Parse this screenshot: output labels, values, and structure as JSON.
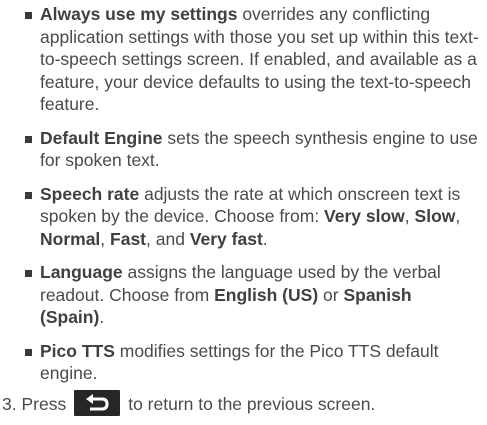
{
  "bullets": [
    {
      "term": "Always use my settings",
      "text": " overrides any conflicting application settings with those you set up within this text-to-speech settings screen. If enabled, and available as a feature, your device defaults to using the text-to-speech feature."
    },
    {
      "term": "Default Engine",
      "text": " sets the speech synthesis engine to use for spoken text."
    },
    {
      "term": "Speech rate",
      "text_a": " adjusts the rate at which onscreen text is spoken by the device. Choose from: ",
      "opt1": "Very slow",
      "sep1": ", ",
      "opt2": "Slow",
      "sep2": ", ",
      "opt3": "Normal",
      "sep3": ", ",
      "opt4": "Fast",
      "sep4": ", and ",
      "opt5": "Very fast",
      "end": "."
    },
    {
      "term": "Language",
      "text_a": " assigns the language used by the verbal readout. Choose from ",
      "opt1": "English (US)",
      "sep1": " or ",
      "opt2": "Spanish (Spain)",
      "end": "."
    },
    {
      "term": "Pico TTS",
      "text": " modifies settings for the Pico TTS default engine."
    }
  ],
  "step": {
    "number": "3.",
    "before": "Press",
    "icon": "back-arrow-icon",
    "after": "to return to the previous screen."
  },
  "colors": {
    "text": "#4a4a4a",
    "button_bg": "#262626",
    "button_icon": "#ffffff"
  }
}
